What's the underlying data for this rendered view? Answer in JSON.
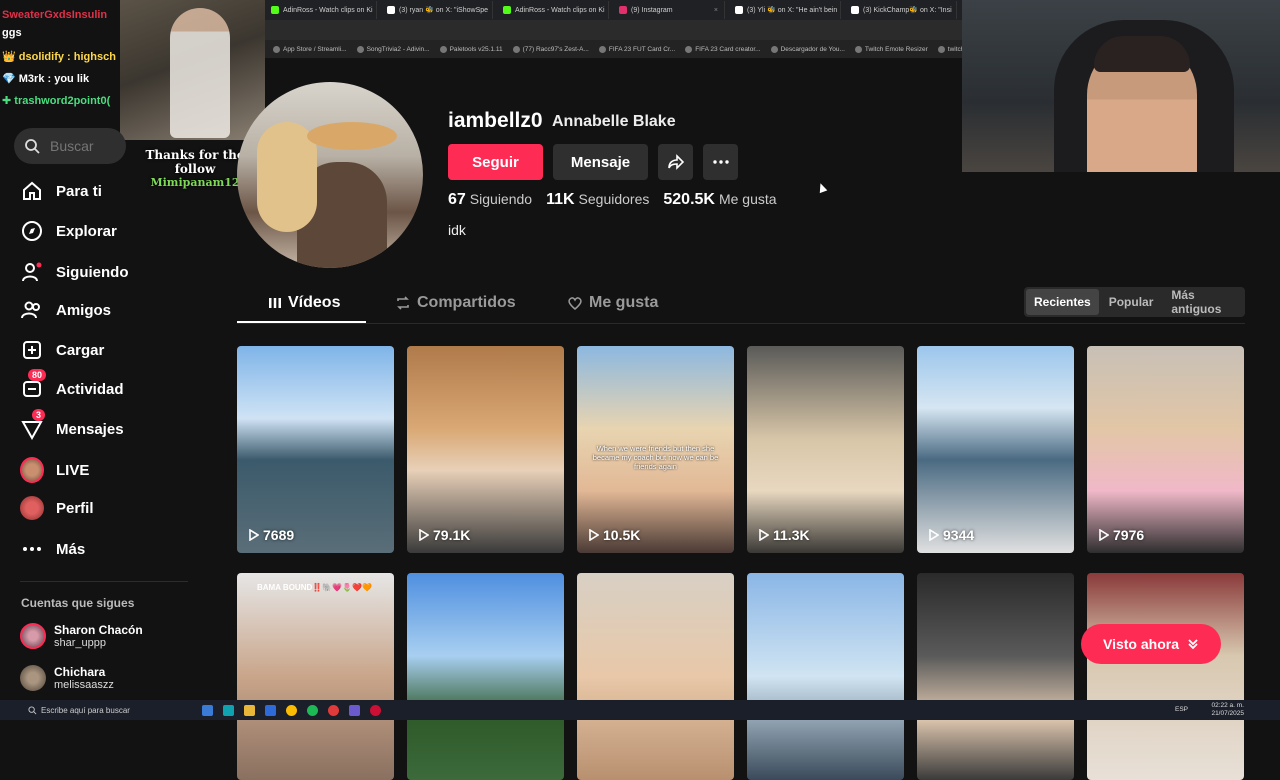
{
  "browser": {
    "tabs": [
      {
        "label": "AdinRoss - Watch clips on Ki",
        "color": "#53fc18"
      },
      {
        "label": "(3) ryan 🐝 on X: \"iShowSpe",
        "color": "#ffffff"
      },
      {
        "label": "AdinRoss - Watch clips on Ki",
        "color": "#53fc18"
      },
      {
        "label": "(9) Instagram",
        "color": "#e1306c"
      },
      {
        "label": "(3) Yli 🐝 on X: \"He ain't bein",
        "color": "#ffffff"
      },
      {
        "label": "(3) KickChamp🐝 on X: \"Insi",
        "color": "#ffffff"
      }
    ],
    "bookmarks": [
      "App Store / Streamli...",
      "SongTrivia2 - Adivin...",
      "Paletools v25.1.11",
      "(77) Racc97's Zest-A...",
      "FIFA 23 FUT Card Cr...",
      "FIFA 23 Card creator...",
      "Descargador de You...",
      "Twitch Emote Resizer",
      "twitch emote resizer..."
    ]
  },
  "overlay": {
    "chat": {
      "line1": "SweaterGxdsInsulin",
      "line2": "ggs",
      "line3": "dsolidify : highsch",
      "line4": "M3rk : you lik",
      "line5": "trashword2point0("
    },
    "follow_alert": {
      "title": "Thanks for the follow",
      "name": "Mimipanam12"
    }
  },
  "sidebar": {
    "search_placeholder": "Buscar",
    "items": [
      {
        "label": "Para ti"
      },
      {
        "label": "Explorar"
      },
      {
        "label": "Siguiendo"
      },
      {
        "label": "Amigos"
      },
      {
        "label": "Cargar"
      },
      {
        "label": "Actividad",
        "badge": "80"
      },
      {
        "label": "Mensajes",
        "badge": "3"
      },
      {
        "label": "LIVE"
      },
      {
        "label": "Perfil"
      },
      {
        "label": "Más"
      }
    ],
    "following_title": "Cuentas que sigues",
    "accounts": [
      {
        "name": "Sharon Chacón",
        "handle": "shar_uppp"
      },
      {
        "name": "Chichara",
        "handle": "melissaaszz"
      }
    ]
  },
  "profile": {
    "username": "iambellz0",
    "full_name": "Annabelle Blake",
    "follow_label": "Seguir",
    "message_label": "Mensaje",
    "following_count": "67",
    "following_label": "Siguiendo",
    "followers_count": "11K",
    "followers_label": "Seguidores",
    "likes_count": "520.5K",
    "likes_label": "Me gusta",
    "bio": "idk"
  },
  "content_tabs": {
    "videos": "Vídeos",
    "reposts": "Compartidos",
    "liked": "Me gusta"
  },
  "sort": {
    "recent": "Recientes",
    "popular": "Popular",
    "oldest": "Más antiguos"
  },
  "videos": [
    {
      "views": "7689"
    },
    {
      "views": "79.1K"
    },
    {
      "views": "10.5K",
      "overlay_text": "When we were friends but then she became my coach but now we can be friends again"
    },
    {
      "views": "11.3K"
    },
    {
      "views": "9344"
    },
    {
      "views": "7976"
    },
    {
      "views": "",
      "caption": "BAMA BOUND‼️🐘💗🌷❤️🧡"
    },
    {
      "views": ""
    },
    {
      "views": ""
    },
    {
      "views": ""
    },
    {
      "views": ""
    },
    {
      "views": ""
    }
  ],
  "visto_ahora": "Visto ahora",
  "taskbar": {
    "search_placeholder": "Escribe aquí para buscar",
    "lang": "ESP",
    "time": "02:22 a. m.",
    "date": "21/07/2025"
  }
}
